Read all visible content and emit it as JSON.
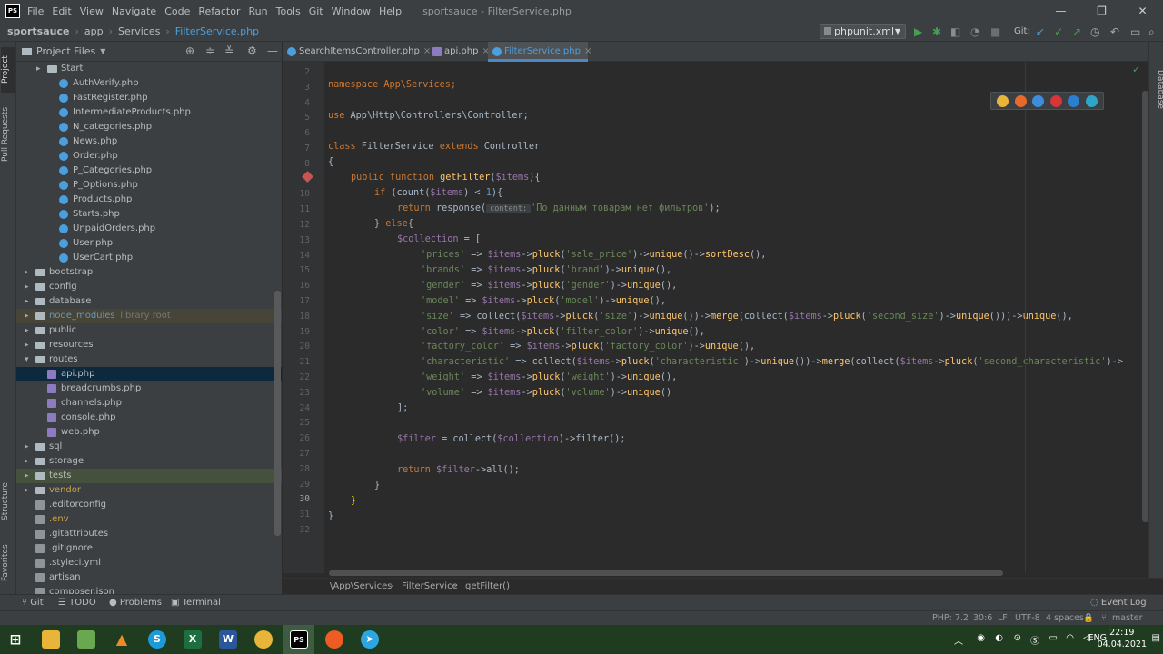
{
  "titlebar": {
    "menu": [
      "File",
      "Edit",
      "View",
      "Navigate",
      "Code",
      "Refactor",
      "Run",
      "Tools",
      "Git",
      "Window",
      "Help"
    ],
    "title": "sportsauce - FilterService.php",
    "min": "—",
    "max": "❐",
    "close": "✕"
  },
  "navbar": {
    "project": "sportsauce",
    "c1": "app",
    "c2": "Services",
    "file": "FilterService.php",
    "run_config": "phpunit.xml",
    "git_label": "Git:"
  },
  "project": {
    "header": "Project Files"
  },
  "tree": [
    {
      "label": "Start",
      "type": "folder",
      "indent": 2,
      "arrow": "▸"
    },
    {
      "label": "AuthVerify.php",
      "type": "php",
      "indent": 3
    },
    {
      "label": "FastRegister.php",
      "type": "php",
      "indent": 3
    },
    {
      "label": "IntermediateProducts.php",
      "type": "php",
      "indent": 3
    },
    {
      "label": "N_categories.php",
      "type": "php",
      "indent": 3
    },
    {
      "label": "News.php",
      "type": "php",
      "indent": 3
    },
    {
      "label": "Order.php",
      "type": "php",
      "indent": 3
    },
    {
      "label": "P_Categories.php",
      "type": "php",
      "indent": 3
    },
    {
      "label": "P_Options.php",
      "type": "php",
      "indent": 3
    },
    {
      "label": "Products.php",
      "type": "php",
      "indent": 3
    },
    {
      "label": "Starts.php",
      "type": "php",
      "indent": 3
    },
    {
      "label": "UnpaidOrders.php",
      "type": "php",
      "indent": 3
    },
    {
      "label": "User.php",
      "type": "php",
      "indent": 3
    },
    {
      "label": "UserCart.php",
      "type": "php",
      "indent": 3
    },
    {
      "label": "bootstrap",
      "type": "folder",
      "indent": 1,
      "arrow": "▸"
    },
    {
      "label": "config",
      "type": "folder",
      "indent": 1,
      "arrow": "▸"
    },
    {
      "label": "database",
      "type": "folder",
      "indent": 1,
      "arrow": "▸"
    },
    {
      "label": "node_modules",
      "type": "folder",
      "indent": 1,
      "arrow": "▸",
      "extra": "library root",
      "style": "nm"
    },
    {
      "label": "public",
      "type": "folder",
      "indent": 1,
      "arrow": "▸"
    },
    {
      "label": "resources",
      "type": "folder",
      "indent": 1,
      "arrow": "▸"
    },
    {
      "label": "routes",
      "type": "folder",
      "indent": 1,
      "arrow": "▾"
    },
    {
      "label": "api.php",
      "type": "route",
      "indent": 2,
      "style": "sel"
    },
    {
      "label": "breadcrumbs.php",
      "type": "route",
      "indent": 2
    },
    {
      "label": "channels.php",
      "type": "route",
      "indent": 2
    },
    {
      "label": "console.php",
      "type": "route",
      "indent": 2
    },
    {
      "label": "web.php",
      "type": "route",
      "indent": 2
    },
    {
      "label": "sql",
      "type": "folder",
      "indent": 1,
      "arrow": "▸"
    },
    {
      "label": "storage",
      "type": "folder",
      "indent": 1,
      "arrow": "▸"
    },
    {
      "label": "tests",
      "type": "folder",
      "indent": 1,
      "arrow": "▸",
      "style": "tst"
    },
    {
      "label": "vendor",
      "type": "folder",
      "indent": 1,
      "arrow": "▸",
      "color": "#c9a14a"
    },
    {
      "label": ".editorconfig",
      "type": "cfg",
      "indent": 1
    },
    {
      "label": ".env",
      "type": "cfg",
      "indent": 1,
      "color": "#c9a14a"
    },
    {
      "label": ".gitattributes",
      "type": "cfg",
      "indent": 1
    },
    {
      "label": ".gitignore",
      "type": "cfg",
      "indent": 1
    },
    {
      "label": ".styleci.yml",
      "type": "cfg",
      "indent": 1
    },
    {
      "label": "artisan",
      "type": "cfg",
      "indent": 1
    },
    {
      "label": "composer.json",
      "type": "cfg",
      "indent": 1
    }
  ],
  "tabs": [
    {
      "label": "SearchItemsController.php"
    },
    {
      "label": "api.php"
    },
    {
      "label": "FilterService.php"
    }
  ],
  "tab_close": "×",
  "gutter": {
    "lines": [
      "2",
      "3",
      "4",
      "5",
      "6",
      "7",
      "8",
      "9",
      "10",
      "11",
      "12",
      "13",
      "14",
      "15",
      "16",
      "17",
      "18",
      "19",
      "20",
      "21",
      "22",
      "23",
      "24",
      "25",
      "26",
      "27",
      "28",
      "29",
      "30",
      "31",
      "32"
    ]
  },
  "code": {
    "l3": "namespace App\\Services;",
    "l5_kw": "use",
    "l5": " App\\Http\\Controllers\\Controller;",
    "l7_kw": "class",
    "l7a": " FilterService ",
    "l7_kw2": "extends",
    "l7b": " Controller",
    "l8": "{",
    "l9_kw": "public function ",
    "l9_fn": "getFilter",
    "l9a": "(",
    "l9_v": "$items",
    "l9b": "){",
    "l10_kw": "if ",
    "l10a": "(count(",
    "l10_v": "$items",
    "l10b": ") < ",
    "l10_n": "1",
    "l10c": "){",
    "l11_kw": "return ",
    "l11a": "response(",
    "l11_hint": "content:",
    "l11_s": "'По данным товарам нет фильтров'",
    "l11b": ");",
    "l12a": "} ",
    "l12_kw": "else",
    "l12b": "{",
    "l13_v": "$collection",
    "l13a": " = [",
    "rows": [
      {
        "key": "'prices'",
        "rest": " => $items->pluck('sale_price')->unique()->sortDesc(),"
      },
      {
        "key": "'brands'",
        "rest": " => $items->pluck('brand')->unique(),"
      },
      {
        "key": "'gender'",
        "rest": " => $items->pluck('gender')->unique(),"
      },
      {
        "key": "'model'",
        "rest": " => $items->pluck('model')->unique(),"
      },
      {
        "key": "'size'",
        "rest": " => collect($items->pluck('size')->unique())->merge(collect($items->pluck('second_size')->unique()))->unique(),"
      },
      {
        "key": "'color'",
        "rest": " => $items->pluck('filter_color')->unique(),"
      },
      {
        "key": "'factory_color'",
        "rest": " => $items->pluck('factory_color')->unique(),"
      },
      {
        "key": "'characteristic'",
        "rest": " => collect($items->pluck('characteristic')->unique())->merge(collect($items->pluck('second_characteristic')->"
      },
      {
        "key": "'weight'",
        "rest": " => $items->pluck('weight')->unique(),"
      },
      {
        "key": "'volume'",
        "rest": " => $items->pluck('volume')->unique()"
      }
    ],
    "l24": "];",
    "l26_v": "$filter",
    "l26a": " = collect(",
    "l26_v2": "$collection",
    "l26b": ")->filter();",
    "l28_kw": "return ",
    "l28_v": "$filter",
    "l28a": "->all();",
    "l29": "}",
    "l30": "}",
    "l31": "}"
  },
  "crumbbar": {
    "a": "\\App\\Services",
    "b": "FilterService",
    "c": "getFilter()"
  },
  "toolwin": {
    "git": "Git",
    "todo": "TODO",
    "problems": "Problems",
    "terminal": "Terminal",
    "eventlog": "Event Log"
  },
  "status": {
    "php": "PHP: 7.2",
    "pos": "30:6",
    "lf": "LF",
    "enc": "UTF-8",
    "indent": "4 spaces",
    "branch": "master"
  },
  "right_tab": "Database",
  "left_tabs": {
    "project": "Project",
    "pull": "Pull Requests",
    "structure": "Structure",
    "favorites": "Favorites"
  },
  "taskbar": {
    "lang": "ENG",
    "time": "22:19",
    "date": "04.04.2021"
  },
  "colors": {
    "accent": "#4a9fde",
    "keyword": "#cc7832",
    "string": "#6a8759",
    "variable": "#9876aa",
    "function": "#ffc66d",
    "number": "#6897bb"
  }
}
